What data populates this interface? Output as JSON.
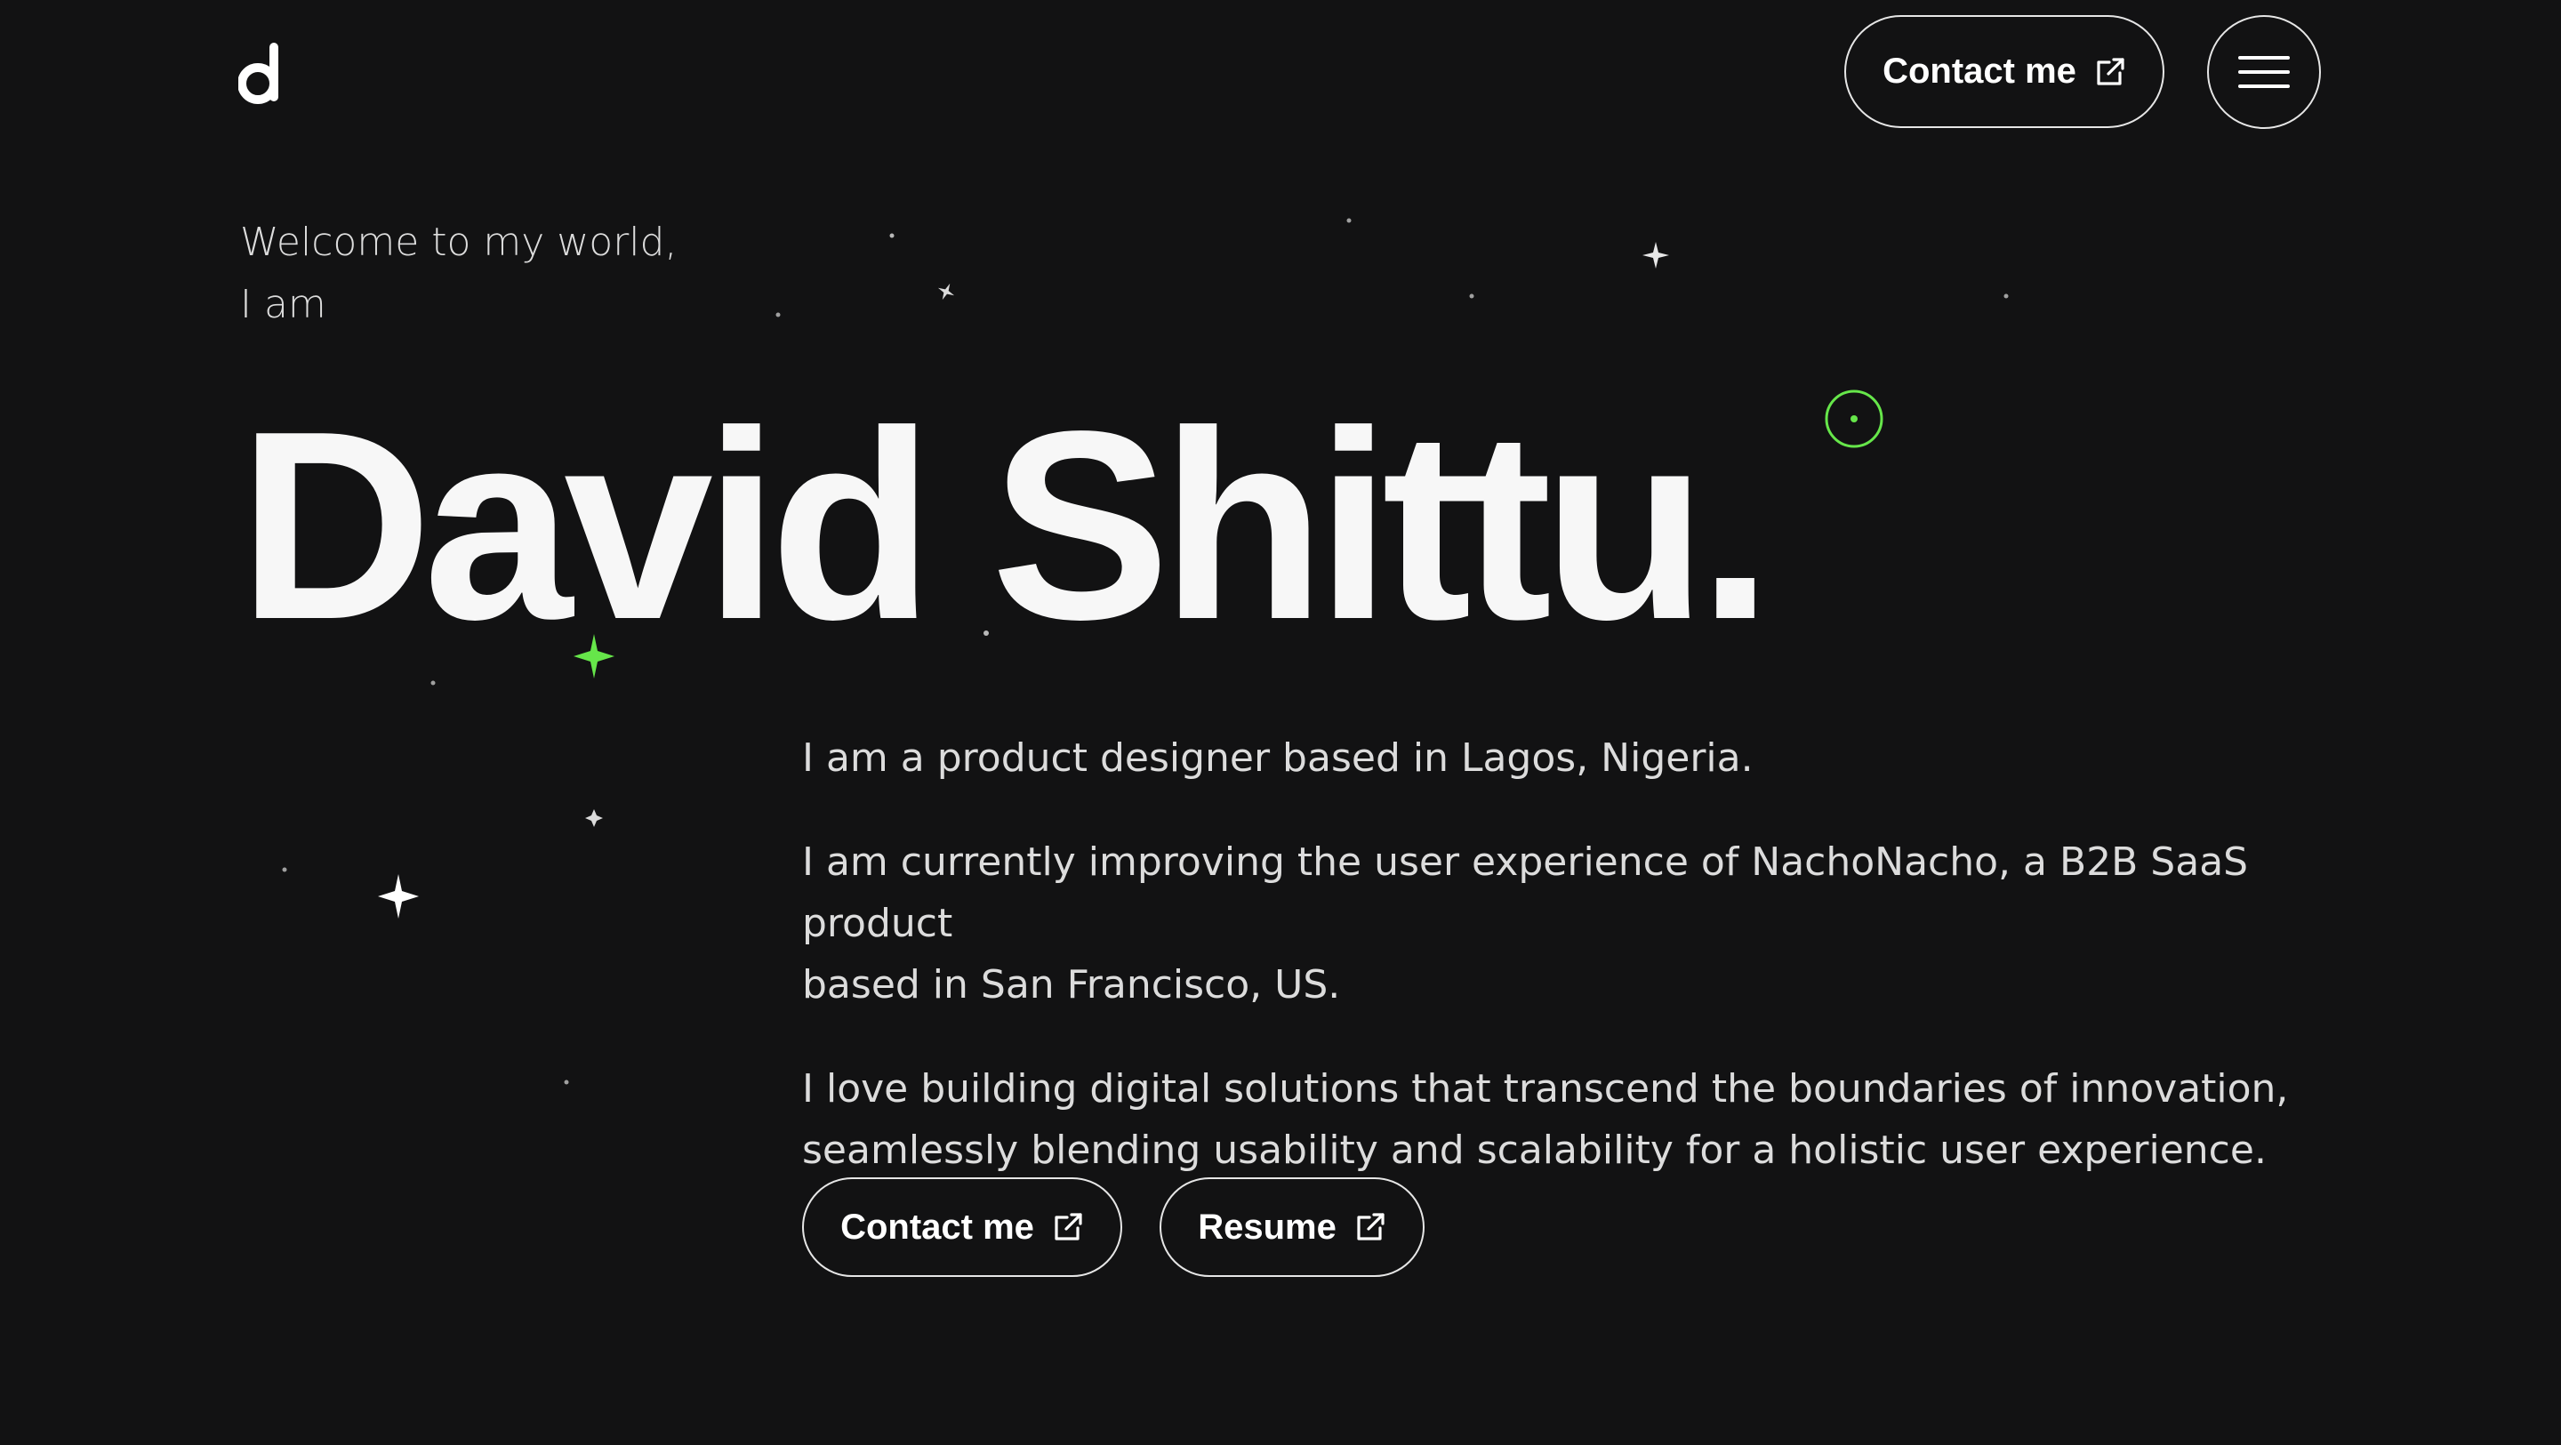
{
  "header": {
    "logo_icon": "d-letter-logo",
    "contact_label": "Contact me",
    "contact_icon": "external-link-icon",
    "menu_icon": "hamburger-menu-icon"
  },
  "hero": {
    "welcome_line1": "Welcome to my world,",
    "welcome_line2": "I am",
    "name": "David Shittu.",
    "accent_color": "#66e64a"
  },
  "bio": {
    "paragraph1": "I am a product designer based in Lagos, Nigeria.",
    "paragraph2_line1": "I am currently improving the user experience of NachoNacho, a B2B SaaS product",
    "paragraph2_line2": "based in San Francisco, US.",
    "paragraph3_line1": "I love building digital solutions that transcend the boundaries of innovation,",
    "paragraph3_line2": "seamlessly blending usability and scalability for a holistic user experience."
  },
  "actions": {
    "contact_label": "Contact me",
    "resume_label": "Resume",
    "icon": "external-link-icon"
  }
}
